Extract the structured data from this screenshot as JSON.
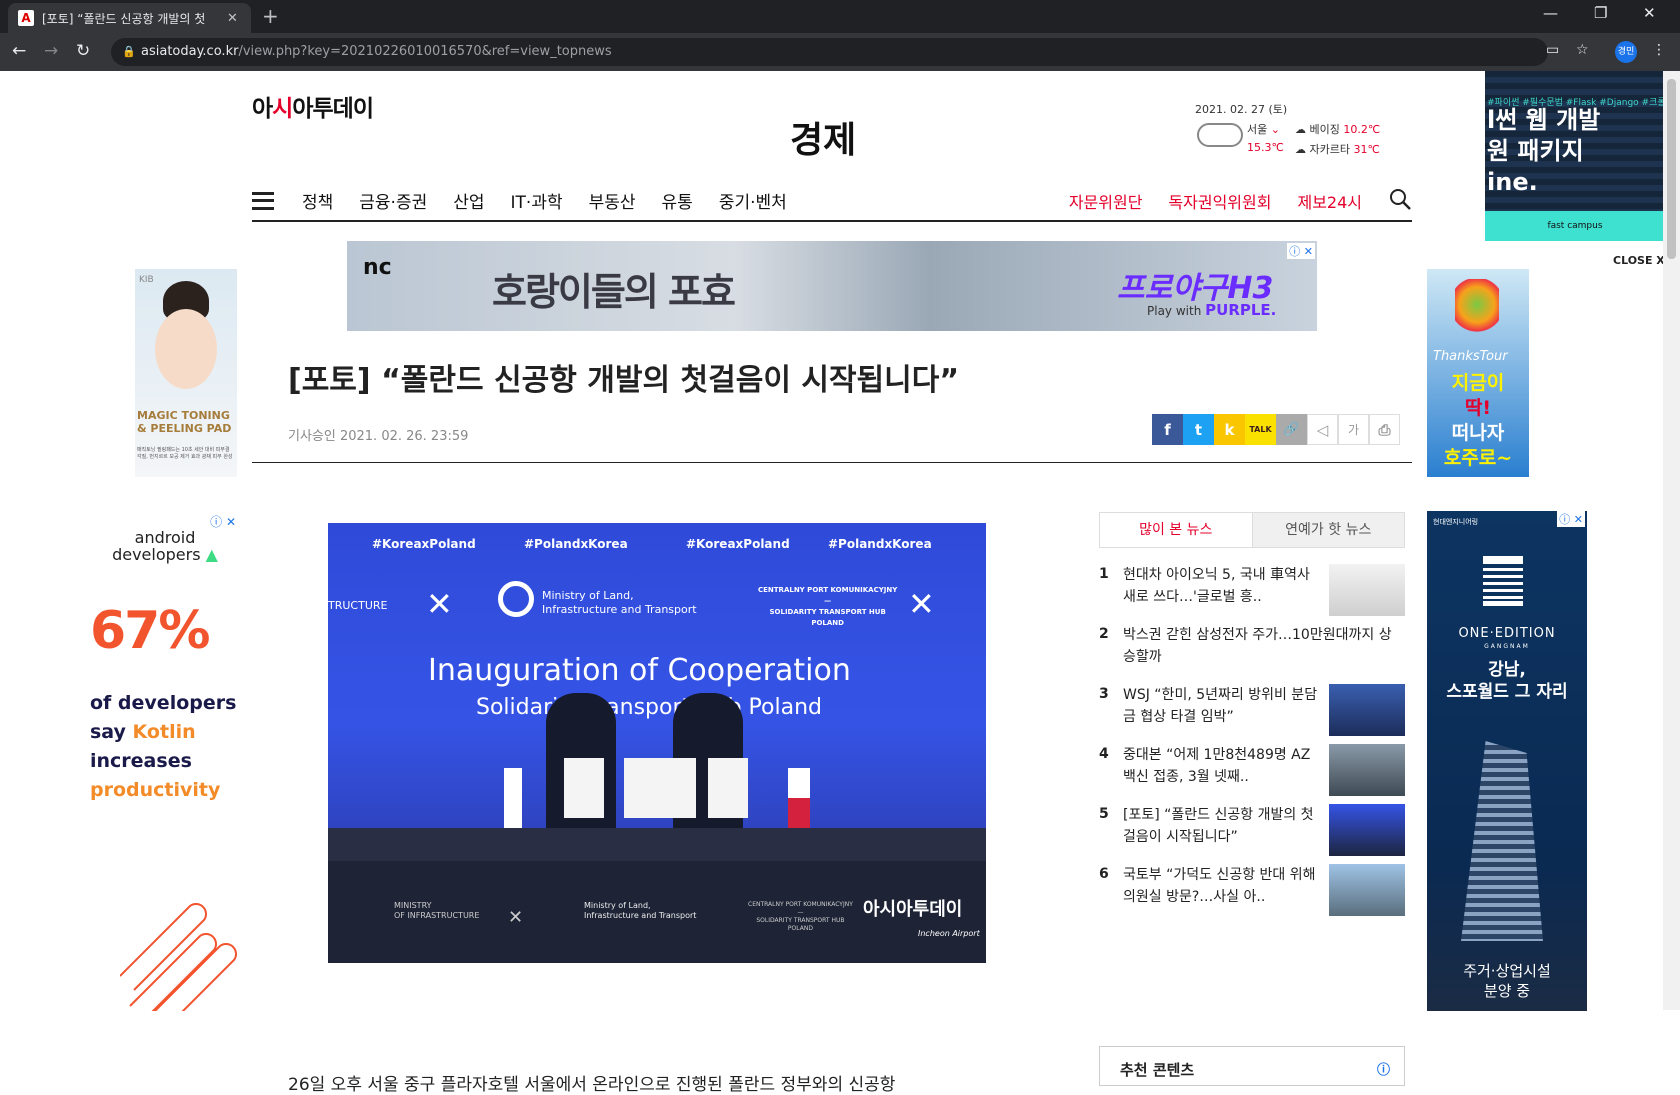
{
  "browser": {
    "tab_title": "[포토] “폴란드 신공항 개발의 첫",
    "tab_close": "✕",
    "new_tab": "+",
    "url_host": "asiatoday.co.kr",
    "url_path": "/view.php?key=20210226010016570&ref=view_topnews",
    "profile_label": "경민",
    "window": {
      "minimize": "—",
      "maximize": "❐",
      "close": "✕"
    }
  },
  "site": {
    "logo_prefix": "아",
    "logo_mark": "시",
    "logo_suffix": "아투데이",
    "section": "경제"
  },
  "weather": {
    "date": "2021. 02. 27 (토)",
    "seoul": "서울",
    "seoul_temp": "15.3℃",
    "city_a": "베이징",
    "city_a_temp": "10.2℃",
    "city_b": "자카르타",
    "city_b_temp": "31℃"
  },
  "gnb": {
    "items": [
      "정책",
      "금융·증권",
      "산업",
      "IT·과학",
      "부동산",
      "유통",
      "중기·벤처"
    ],
    "right": [
      "자문위원단",
      "독자권익위원회",
      "제보24시"
    ]
  },
  "top_ad": {
    "brand": "nc",
    "title": "호랑이들의 포효",
    "game": "프로야구H3",
    "play_with": "Play with",
    "purple": "PURPLE."
  },
  "article": {
    "headline": "[포토] “폴란드 신공항 개발의 첫걸음이 시작됩니다”",
    "byline": "기사승인 2021. 02. 26. 23:59",
    "first_line": "26일 오후 서울 중구 플라자호텔 서울에서 온라인으로 진행된 폴란드 정부와의 신공항"
  },
  "share": {
    "facebook": "f",
    "twitter": "t",
    "kakaostory": "k",
    "talk": "TALK",
    "link": "🔗",
    "speaker": "◁",
    "font": "가",
    "print": "⎙"
  },
  "photo": {
    "tags": [
      "#KoreaxPoland",
      "#PolandxKorea",
      "#KoreaxPoland",
      "#PolandxKorea"
    ],
    "ministry": "Ministry of Land,\nInfrastructure and Transport",
    "cpk": "CENTRALNY PORT KOMUNIKACYJNY\n—\nSOLIDARITY TRANSPORT HUB\nPOLAND",
    "left_cut": "TRUCTURE",
    "inaug": "Inauguration of Cooperation",
    "solidarity": "Solidarity Transport Hub Poland",
    "bottom_left": "MINISTRY\nOF INFRASTRUCTURE",
    "bottom_mid": "Ministry of Land,\nInfrastructure and Transport",
    "bottom_right": "CENTRALNY PORT KOMUNIKACYJNY\n—\nSOLIDARITY TRANSPORT HUB\nPOLAND",
    "watermark": "아시아투데이",
    "airport": "Incheon Airport"
  },
  "ranking": {
    "tab_popular": "많이 본 뉴스",
    "tab_ent": "연예가 핫 뉴스",
    "items": [
      {
        "num": "1",
        "text": "현대차 아이오닉 5, 국내 車역사 새로 쓰다…'글로벌 흥.."
      },
      {
        "num": "2",
        "text": "박스권 갇힌 삼성전자 주가…10만원대까지 상승할까"
      },
      {
        "num": "3",
        "text": "WSJ “한미, 5년짜리 방위비 분담금 협상 타결 임박”"
      },
      {
        "num": "4",
        "text": "중대본 “어제 1만8천489명 AZ백신 접종, 3월 넷째.."
      },
      {
        "num": "5",
        "text": "[포토] “폴란드 신공항 개발의 첫걸음이 시작됩니다”"
      },
      {
        "num": "6",
        "text": "국토부 “가덕도 신공항 반대 위해 의원실 방문?…사실 아.."
      }
    ]
  },
  "reco": {
    "title": "추천 콘텐츠"
  },
  "ads": {
    "left1_brand": "KIB",
    "left1_title": "MAGIC TONING & PEELING PAD",
    "left1_small": "매직토닝 필링패드는 10초 세안 대비 피부결 각질, 번지르르 모공 제거 효과 광채 피부 완성",
    "left2_brand_top": "android",
    "left2_brand_bottom": "developers",
    "left2_pct": "67%",
    "left2_l1": "of developers",
    "left2_l2a": "say ",
    "left2_l2b": "Kotlin",
    "left2_l3": "increases",
    "left2_l4": "productivity",
    "right1_thx": "ThanksTour",
    "right1_t1": "지금이",
    "right1_t2": "딱!",
    "right1_t3": "떠나자",
    "right1_t4": "호주로~",
    "right2_head": "현대엔지니어링",
    "right2_brand": "ONE·EDITION",
    "right2_gn": "GANGNAM",
    "right2_kr1": "강남,",
    "right2_kr2": "스포월드 그 자리",
    "right2_b1": "주거·상업시설",
    "right2_b2": "분양 중",
    "float_tags": "#파이썬 #필수문법 #Flask #Django #크롤링 #실전",
    "float_l1": "l썬 웹 개발",
    "float_l2": "원 패키지",
    "float_l3": "ine.",
    "float_foot": "fast campus",
    "close": "CLOSE X",
    "ad_mark": "ⓘ ✕"
  }
}
